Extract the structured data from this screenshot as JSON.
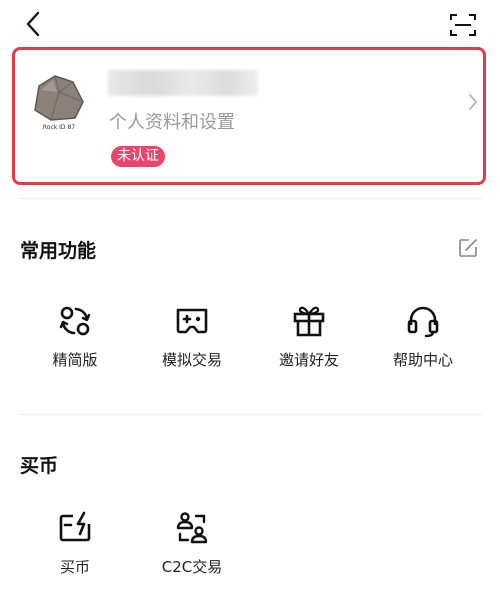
{
  "header": {
    "back_icon": "chevron-left-icon",
    "scan_icon": "scan-icon"
  },
  "profile": {
    "avatar_caption": "Rock ID 87",
    "subtitle": "个人资料和设置",
    "badge": "未认证",
    "badge_color": "#e8466a",
    "highlight_color": "#e53a4a"
  },
  "common": {
    "title": "常用功能",
    "items": [
      {
        "label": "精简版",
        "icon": "lite-version-icon"
      },
      {
        "label": "模拟交易",
        "icon": "demo-trading-icon"
      },
      {
        "label": "邀请好友",
        "icon": "gift-icon"
      },
      {
        "label": "帮助中心",
        "icon": "headset-icon"
      }
    ]
  },
  "buy": {
    "title": "买币",
    "items": [
      {
        "label": "买币",
        "icon": "buy-crypto-icon"
      },
      {
        "label": "C2C交易",
        "icon": "c2c-icon"
      }
    ]
  }
}
